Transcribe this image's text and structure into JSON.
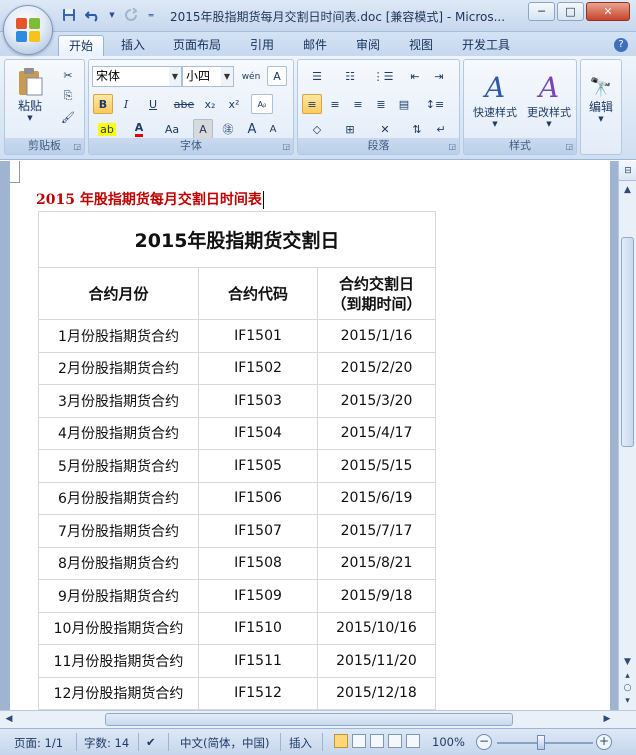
{
  "window": {
    "title": "2015年股指期货每月交割日时间表.doc [兼容模式] - Micros...",
    "controls": {
      "minimize": "─",
      "maximize": "□",
      "close": "✕"
    }
  },
  "qat": {
    "save_icon": "save-icon",
    "undo_icon": "undo-icon",
    "redo_icon": "redo-icon",
    "customize_icon": "customize-icon"
  },
  "tabs": [
    {
      "label": "开始"
    },
    {
      "label": "插入"
    },
    {
      "label": "页面布局"
    },
    {
      "label": "引用"
    },
    {
      "label": "邮件"
    },
    {
      "label": "审阅"
    },
    {
      "label": "视图"
    },
    {
      "label": "开发工具"
    }
  ],
  "ribbon": {
    "clipboard": {
      "label": "剪贴板",
      "paste": "粘贴"
    },
    "font": {
      "label": "字体",
      "font_name": "宋体",
      "font_size": "小四",
      "bold": "B",
      "italic": "I",
      "underline": "U",
      "strike": "abe",
      "sub": "x₂",
      "sup": "x²",
      "wen": "wén",
      "char_border": "A",
      "change_case": "Aa",
      "grow": "A",
      "shrink": "A"
    },
    "paragraph": {
      "label": "段落"
    },
    "styles": {
      "label": "样式",
      "quick_styles": "快速样式",
      "change_styles": "更改样式"
    },
    "editing": {
      "label": "编辑"
    }
  },
  "document": {
    "heading": "2015 年股指期货每月交割日时间表",
    "table": {
      "title": "2015年股指期货交割日",
      "headers": [
        "合约月份",
        "合约代码",
        "合约交割日",
        "（到期时间）"
      ],
      "rows": [
        [
          "1月份股指期货合约",
          "IF1501",
          "2015/1/16"
        ],
        [
          "2月份股指期货合约",
          "IF1502",
          "2015/2/20"
        ],
        [
          "3月份股指期货合约",
          "IF1503",
          "2015/3/20"
        ],
        [
          "4月份股指期货合约",
          "IF1504",
          "2015/4/17"
        ],
        [
          "5月份股指期货合约",
          "IF1505",
          "2015/5/15"
        ],
        [
          "6月份股指期货合约",
          "IF1506",
          "2015/6/19"
        ],
        [
          "7月份股指期货合约",
          "IF1507",
          "2015/7/17"
        ],
        [
          "8月份股指期货合约",
          "IF1508",
          "2015/8/21"
        ],
        [
          "9月份股指期货合约",
          "IF1509",
          "2015/9/18"
        ],
        [
          "10月份股指期货合约",
          "IF1510",
          "2015/10/16"
        ],
        [
          "11月份股指期货合约",
          "IF1511",
          "2015/11/20"
        ],
        [
          "12月份股指期货合约",
          "IF1512",
          "2015/12/18"
        ]
      ]
    }
  },
  "status": {
    "page": "页面: 1/1",
    "words": "字数: 14",
    "language": "中文(简体，中国)",
    "mode": "插入",
    "zoom": "100%",
    "zoom_minus": "−",
    "zoom_plus": "+"
  }
}
